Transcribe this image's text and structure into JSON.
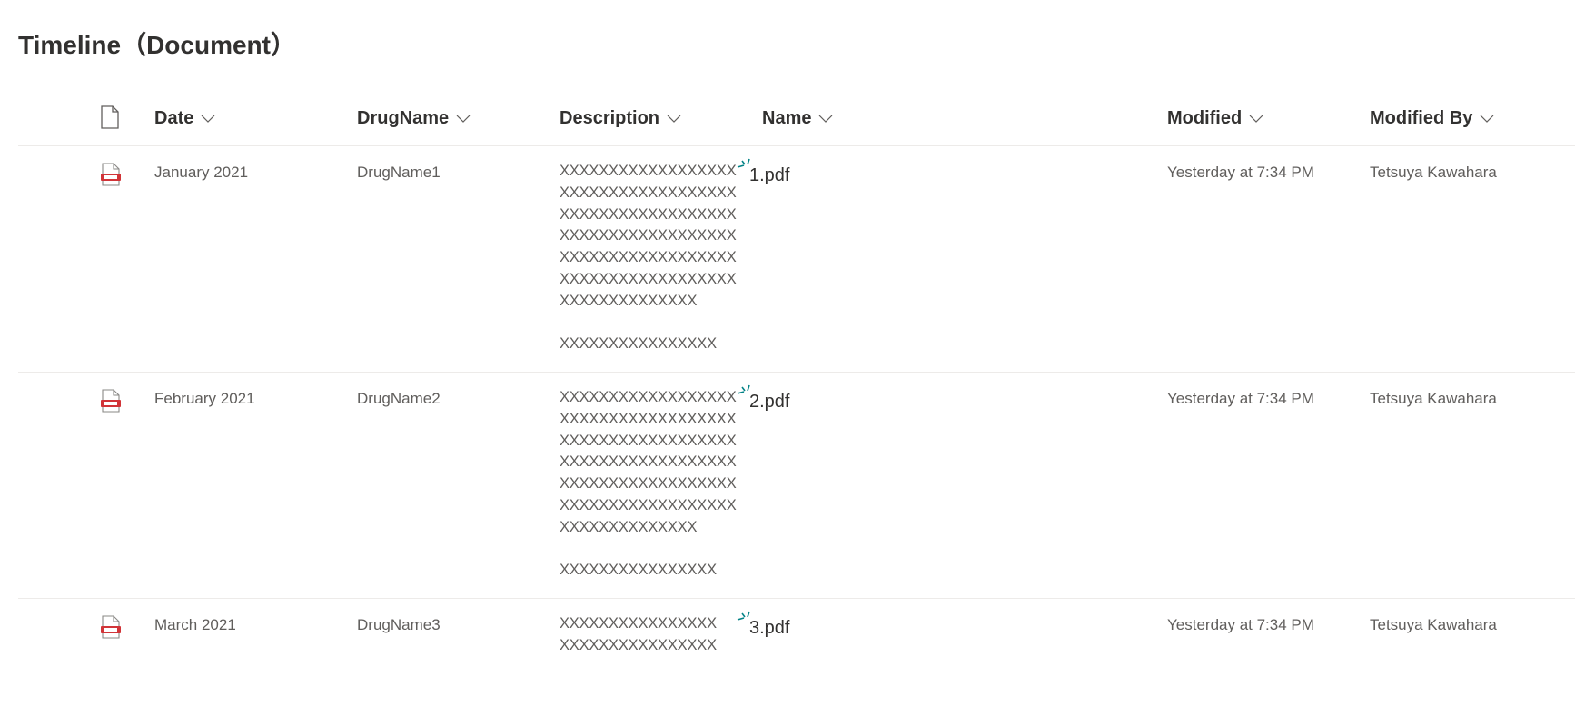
{
  "page": {
    "title": "Timeline（Document）"
  },
  "columns": {
    "date": "Date",
    "drug_name": "DrugName",
    "description": "Description",
    "name": "Name",
    "modified": "Modified",
    "modified_by": "Modified By"
  },
  "rows": [
    {
      "date": "January 2021",
      "drug_name": "DrugName1",
      "description": "XXXXXXXXXXXXXXXXXX\nXXXXXXXXXXXXXXXXXX\nXXXXXXXXXXXXXXXXXX\nXXXXXXXXXXXXXXXXXX\nXXXXXXXXXXXXXXXXXX\nXXXXXXXXXXXXXXXXXX\nXXXXXXXXXXXXXX\n\nXXXXXXXXXXXXXXXX",
      "name": "1.pdf",
      "modified": "Yesterday at 7:34 PM",
      "modified_by": "Tetsuya Kawahara"
    },
    {
      "date": "February 2021",
      "drug_name": "DrugName2",
      "description": "XXXXXXXXXXXXXXXXXX\nXXXXXXXXXXXXXXXXXX\nXXXXXXXXXXXXXXXXXX\nXXXXXXXXXXXXXXXXXX\nXXXXXXXXXXXXXXXXXX\nXXXXXXXXXXXXXXXXXX\nXXXXXXXXXXXXXX\n\nXXXXXXXXXXXXXXXX",
      "name": "2.pdf",
      "modified": "Yesterday at 7:34 PM",
      "modified_by": "Tetsuya Kawahara"
    },
    {
      "date": "March 2021",
      "drug_name": "DrugName3",
      "description": "XXXXXXXXXXXXXXXX\nXXXXXXXXXXXXXXXX",
      "name": "3.pdf",
      "modified": "Yesterday at 7:34 PM",
      "modified_by": "Tetsuya Kawahara"
    }
  ],
  "icons": {
    "file_type": "pdf-file-icon",
    "new_item": "new-item-sparkle-icon",
    "column_header": "document-icon",
    "sort": "chevron-down-icon"
  },
  "colors": {
    "pdf_red": "#d13438",
    "new_teal": "#038387",
    "text_primary": "#323130",
    "text_secondary": "#605e5c",
    "divider": "#edebe9"
  }
}
